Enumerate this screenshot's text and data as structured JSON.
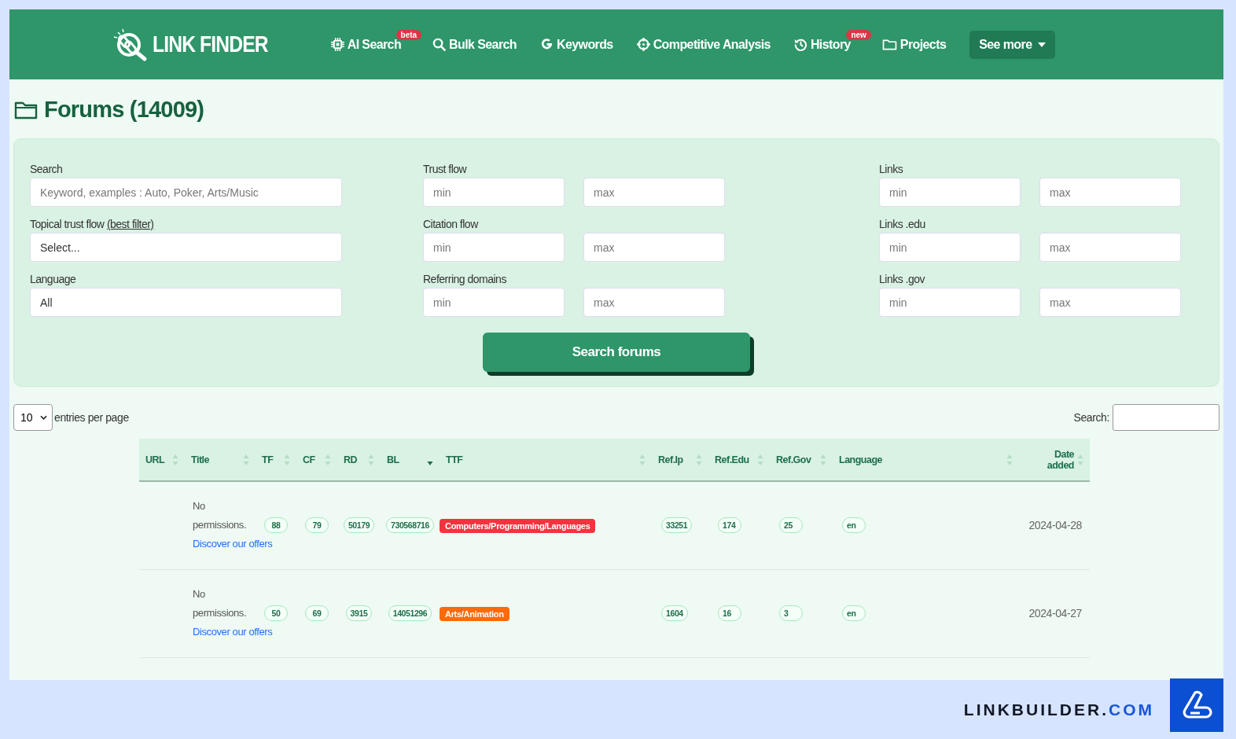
{
  "header": {
    "logo": "LINK FINDER",
    "nav": [
      {
        "kind": "chip",
        "label": "AI Search",
        "badge": "beta"
      },
      {
        "kind": "search",
        "label": "Bulk Search"
      },
      {
        "kind": "google",
        "label": "Keywords"
      },
      {
        "kind": "target",
        "label": "Competitive Analysis"
      },
      {
        "kind": "history",
        "label": "History",
        "badge": "new"
      },
      {
        "kind": "folder",
        "label": "Projects"
      },
      {
        "kind": "dropdown",
        "label": "See more"
      }
    ]
  },
  "page_title": "Forums (14009)",
  "filters": {
    "left": [
      {
        "label": "Search",
        "placeholder": "Keyword, examples : Auto, Poker, Arts/Music"
      },
      {
        "label": "Topical trust flow",
        "link": "(best filter)",
        "value": "Select..."
      },
      {
        "label": "Language",
        "value": "All"
      }
    ],
    "middle": [
      {
        "label": "Trust flow",
        "min": {
          "placeholder": "min"
        },
        "max": {
          "placeholder": "max"
        }
      },
      {
        "label": "Citation flow",
        "min": {
          "placeholder": "min"
        },
        "max": {
          "placeholder": "max"
        }
      },
      {
        "label": "Referring domains",
        "min": {
          "placeholder": "min"
        },
        "max": {
          "placeholder": "max"
        }
      }
    ],
    "right": [
      {
        "label": "Links",
        "min": {
          "placeholder": "min"
        },
        "max": {
          "placeholder": "max"
        }
      },
      {
        "label": "Links .edu",
        "min": {
          "placeholder": "min"
        },
        "max": {
          "placeholder": "max"
        }
      },
      {
        "label": "Links .gov",
        "min": {
          "placeholder": "min"
        },
        "max": {
          "placeholder": "max"
        }
      }
    ],
    "submit": "Search forums"
  },
  "table_controls": {
    "page_size": "10",
    "page_size_label": "entries per page",
    "search_label": "Search:"
  },
  "table": {
    "columns": [
      {
        "label": "URL",
        "sorted": false
      },
      {
        "label": "Title",
        "sorted": false
      },
      {
        "label": "TF",
        "sorted": false
      },
      {
        "label": "CF",
        "sorted": false
      },
      {
        "label": "RD",
        "sorted": false
      },
      {
        "label": "BL",
        "sorted": true
      },
      {
        "label": "TTF",
        "sorted": false
      },
      {
        "label": "Ref.Ip",
        "sorted": false
      },
      {
        "label": "Ref.Edu",
        "sorted": false
      },
      {
        "label": "Ref.Gov",
        "sorted": false
      },
      {
        "label": "Language",
        "sorted": false
      },
      {
        "label": "Date added",
        "sorted": false
      }
    ],
    "rows": [
      {
        "title": "No permissions.",
        "title_link": "Discover our offers",
        "tf": "88",
        "cf": "79",
        "rd": "50179",
        "bl": "730568716",
        "ttf": {
          "label": "Computers/Programming/Languages",
          "color": "#f5333f"
        },
        "ref_ip": "33251",
        "ref_edu": "174",
        "ref_gov": "25",
        "language": "en",
        "date": "2024-04-28"
      },
      {
        "title": "No permissions.",
        "title_link": "Discover our offers",
        "tf": "50",
        "cf": "69",
        "rd": "3915",
        "bl": "14051296",
        "ttf": {
          "label": "Arts/Animation",
          "color": "#fd6a0a"
        },
        "ref_ip": "1604",
        "ref_edu": "16",
        "ref_gov": "3",
        "language": "en",
        "date": "2024-04-27"
      }
    ]
  },
  "footer": {
    "brand": "LINKBUILDER.",
    "brand_tld": "COM"
  }
}
